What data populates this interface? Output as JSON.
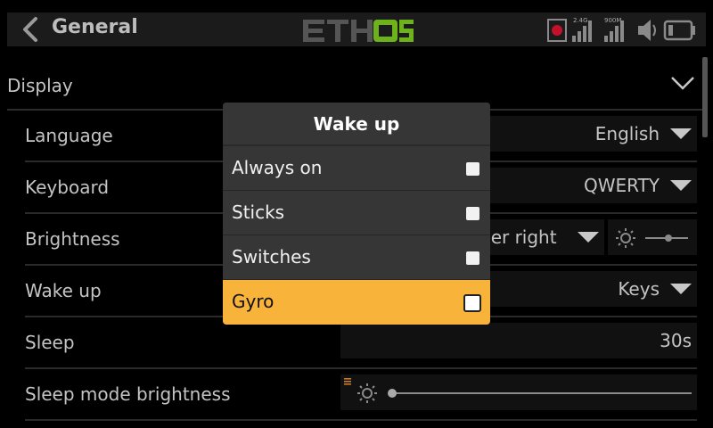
{
  "header": {
    "title": "General",
    "logo_text": "ETHOS",
    "status": {
      "band_24": "2.4G",
      "band_900": "900M"
    }
  },
  "section": {
    "label": "Display"
  },
  "rows": [
    {
      "label": "Language",
      "value": "English"
    },
    {
      "label": "Keyboard",
      "value": "QWERTY"
    },
    {
      "label": "Brightness",
      "value": "der right"
    },
    {
      "label": "Wake up",
      "value": "Keys"
    },
    {
      "label": "Sleep",
      "value": "30s"
    },
    {
      "label": "Sleep mode brightness",
      "value": ""
    }
  ],
  "dialog": {
    "title": "Wake up",
    "options": [
      {
        "label": "Always on",
        "checked": false
      },
      {
        "label": "Sticks",
        "checked": false
      },
      {
        "label": "Switches",
        "checked": false
      },
      {
        "label": "Gyro",
        "checked": false,
        "selected": true
      }
    ]
  },
  "colors": {
    "accent": "#f8b33a",
    "logo_green": "#6db21a",
    "logo_gray": "#555555",
    "record": "#c0122a"
  }
}
